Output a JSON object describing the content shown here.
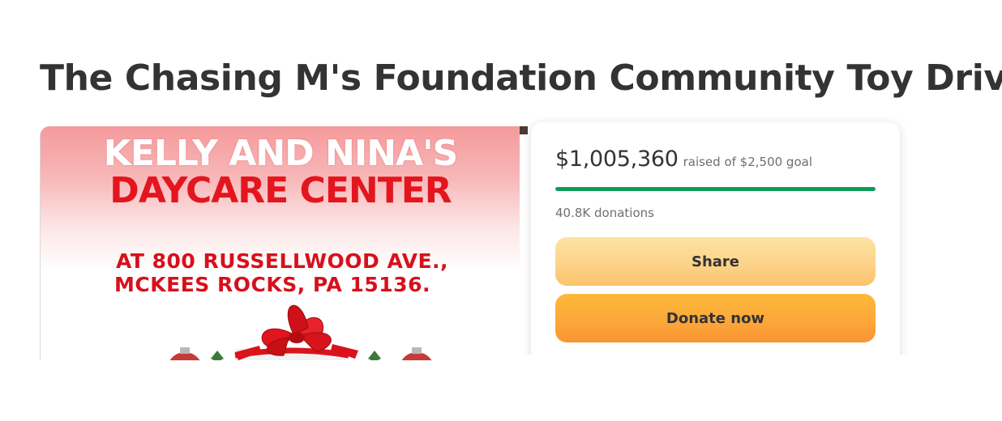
{
  "campaign": {
    "title": "The Chasing M's Foundation Community Toy Drive"
  },
  "flyer": {
    "line1": "KELLY AND NINA'S",
    "line2": "DAYCARE CENTER",
    "address_line1": "AT 800 RUSSELLWOOD AVE.,",
    "address_line2": "MCKEES ROCKS, PA 15136."
  },
  "donation_card": {
    "raised_amount": "$1,005,360",
    "goal_text": "raised of $2,500 goal",
    "progress_fraction": 1.0,
    "donations_count": "40.8K donations",
    "share_label": "Share",
    "donate_label": "Donate now",
    "progress_color": "#0e9a57"
  }
}
